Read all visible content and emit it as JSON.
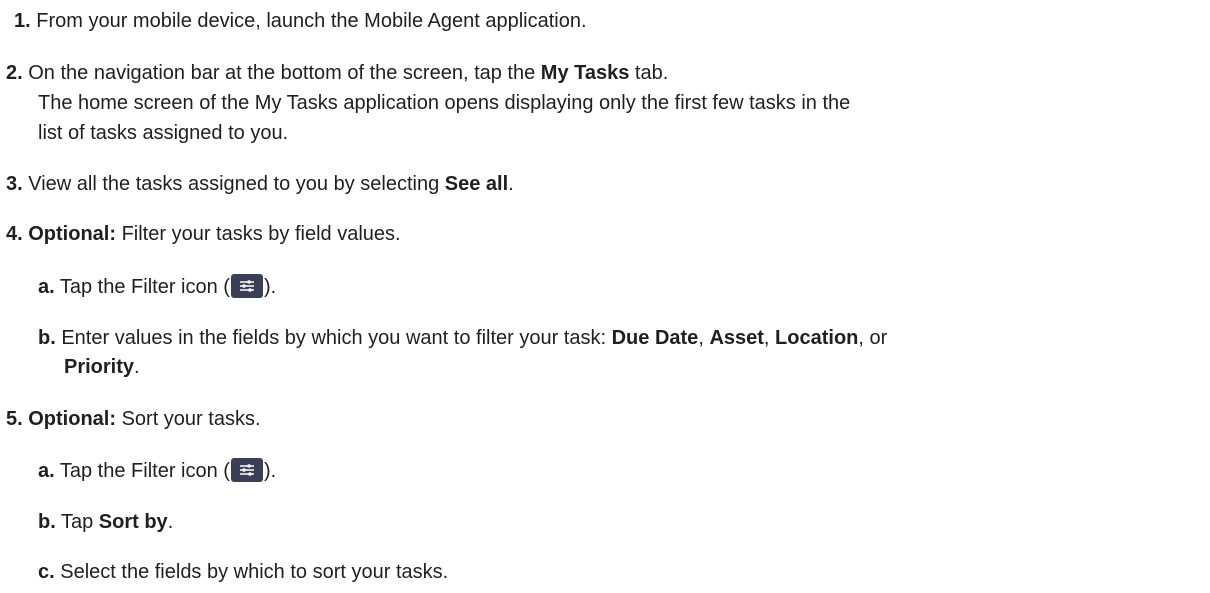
{
  "steps": {
    "s1": {
      "num": "1.",
      "text": " From your mobile device, launch the Mobile Agent application."
    },
    "s2": {
      "num": "2.",
      "text_a": " On the navigation bar at the bottom of the screen, tap the ",
      "bold": "My Tasks",
      "text_b": " tab.",
      "result_line1": "The home screen of the My Tasks application opens displaying only the first few tasks in the",
      "result_line2": "list of tasks assigned to you."
    },
    "s3": {
      "num": "3.",
      "text_a": " View all the tasks assigned to you by selecting ",
      "bold": "See all",
      "text_b": "."
    },
    "s4": {
      "num": "4.",
      "optional": " Optional:",
      "text": "  Filter your tasks by field values.",
      "a": {
        "letter": "a.",
        "text_a": " Tap the Filter icon (",
        "text_b": ")."
      },
      "b": {
        "letter": "b.",
        "text_a": " Enter values in the fields by which you want to filter your task: ",
        "f1": "Due Date",
        "sep1": ", ",
        "f2": "Asset",
        "sep2": ", ",
        "f3": "Location",
        "sep3": ", or",
        "f4": "Priority",
        "end": "."
      }
    },
    "s5": {
      "num": "5.",
      "optional": " Optional:",
      "text": "  Sort your tasks.",
      "a": {
        "letter": "a.",
        "text_a": " Tap the Filter icon (",
        "text_b": ")."
      },
      "b": {
        "letter": "b.",
        "text_a": " Tap ",
        "bold": "Sort by",
        "text_b": "."
      },
      "c": {
        "letter": "c.",
        "text": " Select the fields by which to sort your tasks."
      }
    }
  },
  "icons": {
    "filter_icon_bg": "#3b3e56",
    "filter_icon_name": "filter-sliders-icon"
  }
}
